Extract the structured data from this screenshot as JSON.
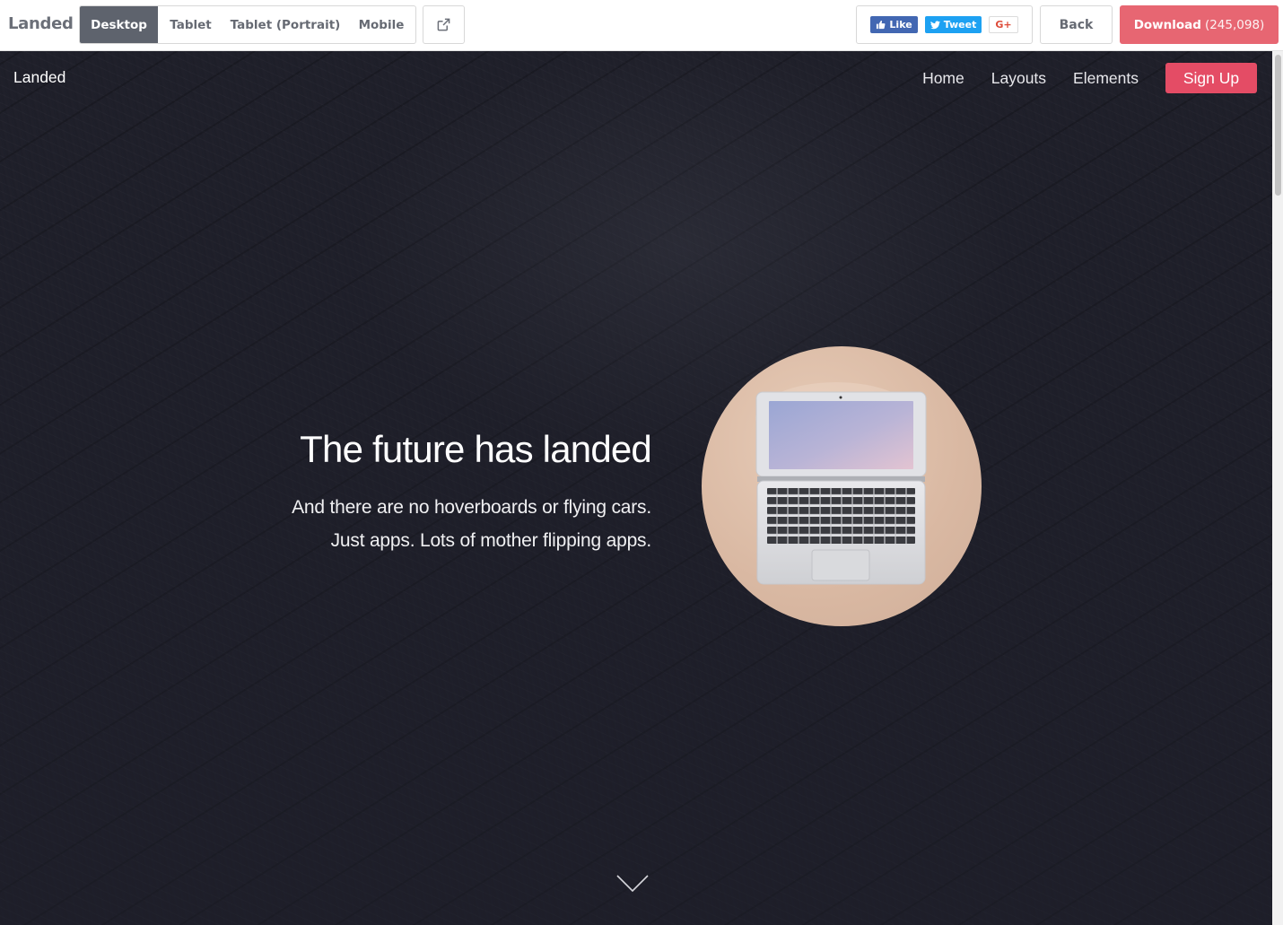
{
  "toolbar": {
    "brand": "Landed",
    "devices": [
      "Desktop",
      "Tablet",
      "Tablet (Portrait)",
      "Mobile"
    ],
    "active_device": "Desktop",
    "popout_icon": "external-link-icon",
    "social": {
      "like": "Like",
      "tweet": "Tweet",
      "gplus": "G+"
    },
    "back": "Back",
    "download_label": "Download",
    "download_count": "(245,098)",
    "accent": "#e76672"
  },
  "site": {
    "logo": "Landed",
    "nav": [
      "Home",
      "Layouts",
      "Elements"
    ],
    "signup": "Sign Up",
    "accent": "#e44c65"
  },
  "hero": {
    "title": "The future has landed",
    "subtitle_line1": "And there are no hoverboards or flying cars.",
    "subtitle_line2": "Just apps. Lots of mother flipping apps.",
    "image_icon": "laptop-photo",
    "scroll_icon": "chevron-down-icon"
  }
}
